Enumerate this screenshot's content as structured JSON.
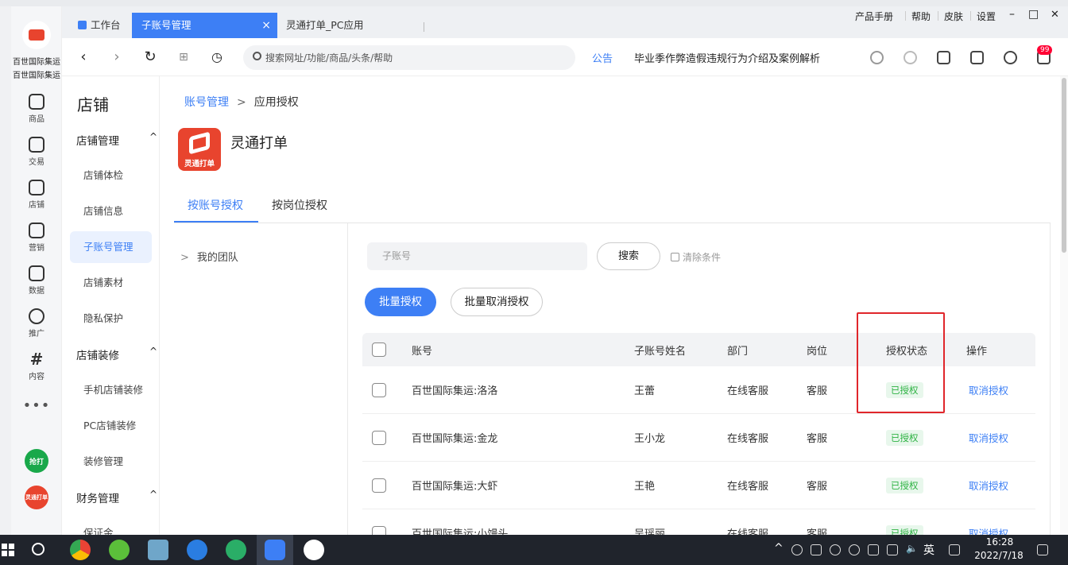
{
  "shop_name": "百世国际集运",
  "left_rail": [
    {
      "label": "商品"
    },
    {
      "label": "交易"
    },
    {
      "label": "店铺"
    },
    {
      "label": "营销"
    },
    {
      "label": "数据"
    },
    {
      "label": "推广"
    },
    {
      "label": "内容"
    }
  ],
  "rail_apps": [
    {
      "label": "抢打",
      "color": "#19a84a"
    },
    {
      "label": "灵通打单",
      "color": "#e8442e"
    }
  ],
  "tabs": [
    {
      "label": "工作台"
    },
    {
      "label": "子账号管理",
      "close": "×"
    },
    {
      "label": "灵通打单_PC应用"
    }
  ],
  "top_menu": [
    "产品手册",
    "帮助",
    "皮肤",
    "设置"
  ],
  "window_controls": {
    "minimize": "–",
    "maximize": "□",
    "close": "✕"
  },
  "address_bar": {
    "placeholder": "搜索网址/功能/商品/头条/帮助",
    "notice_label": "公告",
    "notice_text": "毕业季作弊造假违规行为介绍及案例解析",
    "message_badge": "99"
  },
  "sidenav": {
    "title": "店铺",
    "groups": [
      {
        "label": "店铺管理",
        "items": [
          "店铺体检",
          "店铺信息",
          "子账号管理",
          "店铺素材",
          "隐私保护"
        ]
      },
      {
        "label": "店铺装修",
        "items": [
          "手机店铺装修",
          "PC店铺装修",
          "装修管理"
        ]
      },
      {
        "label": "财务管理",
        "items": [
          "保证金"
        ]
      }
    ],
    "active_item": "子账号管理",
    "caret": "^"
  },
  "breadcrumb": {
    "parent": "账号管理",
    "separator": ">",
    "current": "应用授权"
  },
  "app": {
    "name": "灵通打单",
    "logo_text": "灵通打单"
  },
  "content_tabs": [
    {
      "label": "按账号授权",
      "active": true
    },
    {
      "label": "按岗位授权",
      "active": false
    }
  ],
  "team_tree": {
    "arrow": ">",
    "label": "我的团队"
  },
  "filter": {
    "sub_account_placeholder": "子账号",
    "search_button": "搜索",
    "clear_label": "清除条件"
  },
  "batch": {
    "authorize": "批量授权",
    "cancel": "批量取消授权"
  },
  "table": {
    "columns": [
      "账号",
      "子账号姓名",
      "部门",
      "岗位",
      "授权状态",
      "操作"
    ],
    "rows": [
      {
        "account": "百世国际集运:洛洛",
        "name": "王蕾",
        "dept": "在线客服",
        "role": "客服",
        "status": "已授权",
        "action": "取消授权"
      },
      {
        "account": "百世国际集运:金龙",
        "name": "王小龙",
        "dept": "在线客服",
        "role": "客服",
        "status": "已授权",
        "action": "取消授权"
      },
      {
        "account": "百世国际集运:大虾",
        "name": "王艳",
        "dept": "在线客服",
        "role": "客服",
        "status": "已授权",
        "action": "取消授权"
      },
      {
        "account": "百世国际集运:小馒头",
        "name": "吴瑶丽",
        "dept": "在线客服",
        "role": "客服",
        "status": "已授权",
        "action": "取消授权"
      }
    ]
  },
  "taskbar": {
    "ime": "英",
    "time": "16:28",
    "date": "2022/7/18"
  },
  "colors": {
    "accent": "#3d7ff5",
    "status_green": "#2fb344",
    "highlight_red": "#e0262b"
  }
}
